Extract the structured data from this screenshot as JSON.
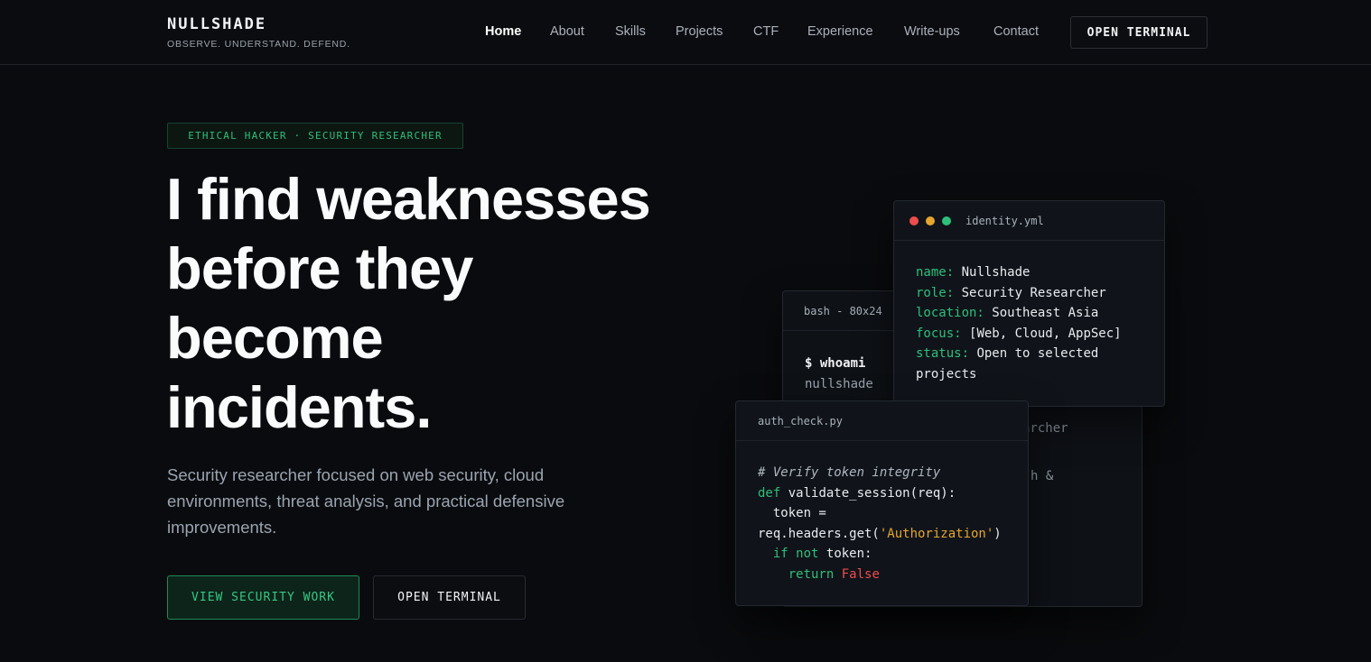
{
  "header": {
    "brand_name": "NULLSHADE",
    "brand_tagline": "OBSERVE. UNDERSTAND. DEFEND.",
    "nav": [
      "Home",
      "About",
      "Skills",
      "Projects",
      "CTF",
      "Experience",
      "Write-ups",
      "Contact"
    ],
    "active_nav": "Home",
    "terminal_button": "OPEN TERMINAL"
  },
  "hero": {
    "badge": "ETHICAL HACKER · SECURITY RESEARCHER",
    "headline_lines": [
      "I find weaknesses",
      "before they",
      "become",
      "incidents."
    ],
    "lead": "Security researcher focused on web security, cloud environments, threat analysis, and practical defensive improvements.",
    "primary_button": "VIEW SECURITY WORK",
    "secondary_button": "OPEN TERMINAL"
  },
  "windows": {
    "bash": {
      "title": "bash - 80x24",
      "command": "$ whoami",
      "output": "nullshade",
      "partial_line_1": "archer",
      "partial_line_2": "h &"
    },
    "identity": {
      "title": "identity.yml",
      "fields": [
        {
          "key": "name:",
          "value": "Nullshade"
        },
        {
          "key": "role:",
          "value": "Security Researcher"
        },
        {
          "key": "location:",
          "value": "Southeast Asia"
        },
        {
          "key": "focus:",
          "value": "[Web, Cloud, AppSec]"
        },
        {
          "key": "status:",
          "value": "Open to selected projects"
        }
      ]
    },
    "auth": {
      "title": "auth_check.py",
      "comment": "# Verify token integrity",
      "kw_def": "def",
      "fn_sig": "validate_session(req):",
      "token_assign": "  token =",
      "token_expr_pre": "req.headers.get(",
      "token_expr_str": "'Authorization'",
      "token_expr_post": ")",
      "kw_if": "if",
      "kw_not": "not",
      "if_rest": "token:",
      "kw_return": "return",
      "kw_false": "False"
    }
  },
  "colors": {
    "accent_green": "#2fbf7a",
    "dot_red": "#ef4c4c",
    "dot_yellow": "#e6a52e",
    "dot_green": "#2fbf7a"
  }
}
